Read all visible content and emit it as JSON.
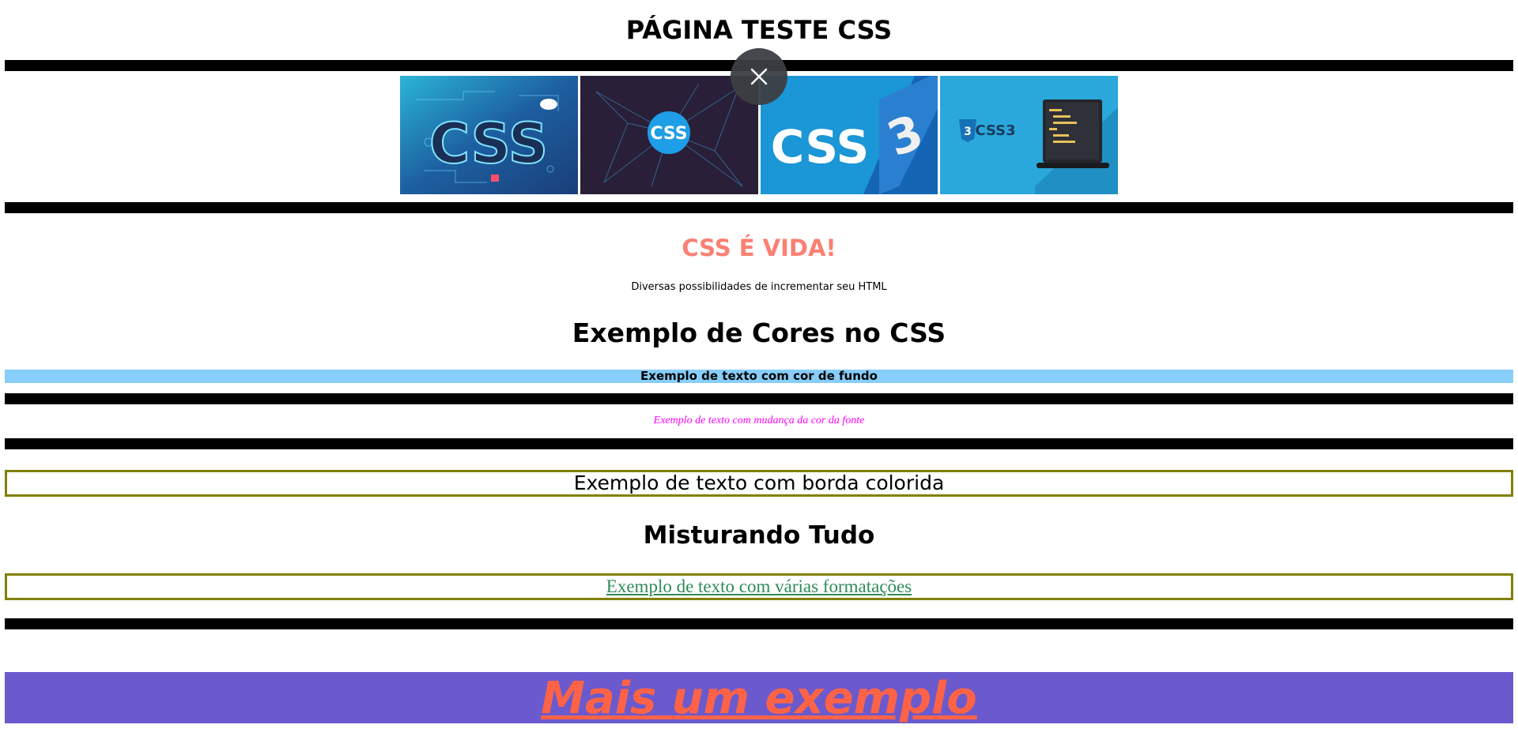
{
  "page": {
    "title": "PÁGINA TESTE CSS"
  },
  "gallery": {
    "images": [
      {
        "name": "css-neon-banner",
        "text": "CSS",
        "bg": "#1b4a86"
      },
      {
        "name": "css-network-banner",
        "text": "CSS",
        "bg": "#2a1f38"
      },
      {
        "name": "css3-logo-banner",
        "text": "CSS",
        "bg": "#1b96d6"
      },
      {
        "name": "css3-laptop-banner",
        "text": "CSS3",
        "bg": "#2aa8dc"
      }
    ],
    "close_icon": "close-icon"
  },
  "hero": {
    "title": "CSS É VIDA!",
    "subtitle": "Diversas possibilidades de incrementar seu HTML",
    "title_color": "#fa8072"
  },
  "colors_section": {
    "heading": "Exemplo de Cores no CSS",
    "background_example": "Exemplo de texto com cor de fundo",
    "background_color": "#87cefa",
    "font_color_example": "Exemplo de texto com mudança da cor da fonte",
    "font_color": "#ff00ff",
    "border_example": "Exemplo de texto com borda colorida",
    "border_color": "#808000"
  },
  "mix_section": {
    "heading": "Misturando Tudo",
    "mixed_example": "Exemplo de texto com várias formatações",
    "mixed_text_color": "#2e8b57",
    "mixed_border_color": "#808000"
  },
  "banner": {
    "text": "Mais um exemplo",
    "background": "#6a5acd",
    "text_color": "#ff6347"
  }
}
